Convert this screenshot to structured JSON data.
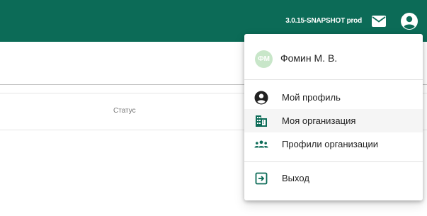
{
  "header": {
    "version": "3.0.15-SNAPSHOT prod",
    "mail_icon": "mail-icon",
    "account_icon": "account-circle-icon"
  },
  "table": {
    "columns": [
      "Статус"
    ]
  },
  "user_menu": {
    "avatar_initials": "ФМ",
    "user_name": "Фомин М. В.",
    "items": [
      {
        "label": "Мой профиль",
        "icon": "account-circle-icon"
      },
      {
        "label": "Моя организация",
        "icon": "building-icon"
      },
      {
        "label": "Профили организации",
        "icon": "people-icon"
      }
    ],
    "logout_label": "Выход",
    "logout_icon": "exit-icon"
  },
  "colors": {
    "brand": "#0c6b57",
    "icon": "#212121",
    "accent_icon": "#0c6b57",
    "avatar_bg": "#c8e6c9"
  }
}
